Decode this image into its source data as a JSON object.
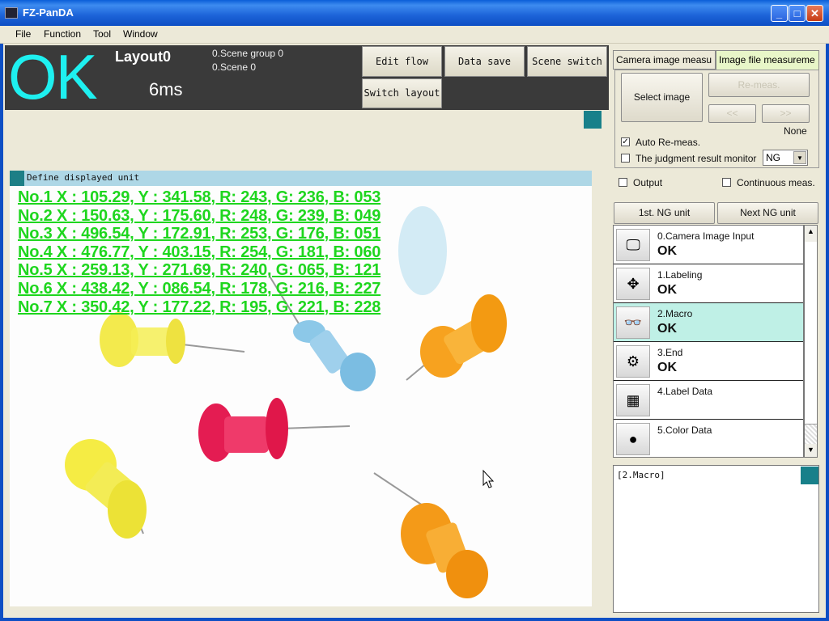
{
  "window": {
    "title": "FZ-PanDA",
    "minimize": "_",
    "maximize": "□",
    "close": "✕"
  },
  "menu": [
    "File",
    "Function",
    "Tool",
    "Window"
  ],
  "status": {
    "judgement": "OK",
    "layout": "Layout0",
    "elapsed": "6ms",
    "scene_group": "0.Scene group 0",
    "scene": "0.Scene 0"
  },
  "toolbar": {
    "edit_flow": "Edit flow",
    "data_save": "Data save",
    "scene_switch": "Scene switch",
    "switch_layout": "Switch layout"
  },
  "display": {
    "define_unit": "Define displayed unit",
    "results": [
      "No.1  X : 105.29, Y : 341.58, R: 243, G: 236, B: 053",
      "No.2  X : 150.63, Y : 175.60, R: 248, G: 239, B: 049",
      "No.3  X : 496.54, Y : 172.91, R: 253, G: 176, B: 051",
      "No.4  X : 476.77, Y : 403.15, R: 254, G: 181, B: 060",
      "No.5  X : 259.13, Y : 271.69, R: 240, G: 065, B: 121",
      "No.6  X : 438.42, Y : 086.54, R: 178, G: 216, B: 227",
      "No.7  X : 350.42, Y : 177.22, R: 195, G: 221, B: 228"
    ]
  },
  "tabs": {
    "camera": "Camera image measu",
    "file": "Image file measureme"
  },
  "controls": {
    "select_image": "Select image",
    "re_meas": "Re-meas.",
    "prev": "<<",
    "next": ">>",
    "file_name": "None",
    "auto_remeas": "Auto Re-meas.",
    "judgment_monitor": "The judgment result monitor",
    "judgment_value": "NG",
    "output": "Output",
    "continuous": "Continuous meas.",
    "first_ng": "1st. NG unit",
    "next_ng": "Next NG unit"
  },
  "flow": [
    {
      "name": "0.Camera Image Input",
      "status": "OK",
      "icon": "camera-icon"
    },
    {
      "name": "1.Labeling",
      "status": "OK",
      "icon": "labeling-icon"
    },
    {
      "name": "2.Macro",
      "status": "OK",
      "icon": "glasses-icon"
    },
    {
      "name": "3.End",
      "status": "OK",
      "icon": "flowchart-icon"
    },
    {
      "name": "4.Label Data",
      "status": "",
      "icon": "label-data-icon"
    },
    {
      "name": "5.Color Data",
      "status": "",
      "icon": "color-data-icon"
    }
  ],
  "detail": "[2.Macro]",
  "colors": {
    "ok": "#1ef0f0",
    "result_text": "#1ed61e",
    "selected_unit": "#bff0e6",
    "accent_teal": "#18808a"
  }
}
